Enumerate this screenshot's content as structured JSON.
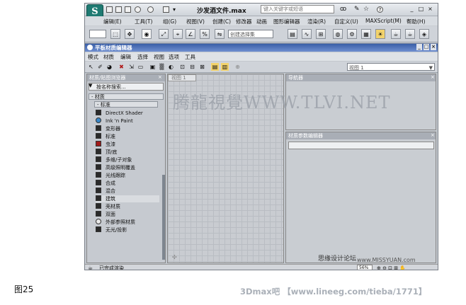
{
  "app": {
    "title": "沙发酒文件.max",
    "search_placeholder": "键入关键字或短语",
    "logo_letter": "S",
    "window_buttons": [
      "_",
      "□",
      "×"
    ],
    "menu": [
      "编辑(E)",
      "工具(T)",
      "组(G)",
      "视图(V)",
      "创建(C)",
      "修改器",
      "动画",
      "图形编辑器",
      "渲染(R)",
      "自定义(U)",
      "MAXScript(M)",
      "帮助(H)"
    ],
    "selection_set_placeholder": "创建选择集"
  },
  "sme": {
    "title": "平板材质编辑器",
    "window_buttons": [
      "_",
      "□",
      "×"
    ],
    "menu": [
      "模式",
      "材质",
      "编辑",
      "选择",
      "视图",
      "选项",
      "工具"
    ],
    "view_selector": "视图 1",
    "browser": {
      "title": "材质/贴图浏览器",
      "search_placeholder": "按名称搜索...",
      "group": "- 材质",
      "subgroup": "- 标准",
      "items": [
        {
          "label": "DirectX Shader",
          "swatch": "#2a2a2a"
        },
        {
          "label": "Ink 'n Paint",
          "swatch": "#3a88c9"
        },
        {
          "label": "变形器",
          "swatch": "#2a2a2a"
        },
        {
          "label": "标准",
          "swatch": "#2a2a2a"
        },
        {
          "label": "虫漆",
          "swatch": "#a11a1a"
        },
        {
          "label": "顶/底",
          "swatch": "#2a2a2a"
        },
        {
          "label": "多维/子对象",
          "swatch": "#2a2a2a"
        },
        {
          "label": "高级照明覆盖",
          "swatch": "#2a2a2a"
        },
        {
          "label": "光线跟踪",
          "swatch": "#2a2a2a"
        },
        {
          "label": "合成",
          "swatch": "#2a2a2a"
        },
        {
          "label": "混合",
          "swatch": "#2a2a2a"
        },
        {
          "label": "建筑",
          "swatch": "#2a2a2a"
        },
        {
          "label": "壳材质",
          "swatch": "#2a2a2a"
        },
        {
          "label": "双面",
          "swatch": "#2a2a2a"
        },
        {
          "label": "外部参照材质",
          "swatch": "#e8e8e8"
        },
        {
          "label": "无光/投影",
          "swatch": "#2a2a2a"
        }
      ]
    },
    "view_tab": "视图 1",
    "navigator_title": "导航器",
    "params_title": "材质参数编辑器",
    "status": "已完成渲染",
    "zoom": "56%"
  },
  "watermark": "腾龍視覺WWW.TLVI.NET",
  "forum_watermark": "思缘设计论坛",
  "forum_url": "www.MISSYUAN.com",
  "caption": "图25",
  "footer": "3Dmax吧 【www.lineeg.com/tieba/1771】"
}
